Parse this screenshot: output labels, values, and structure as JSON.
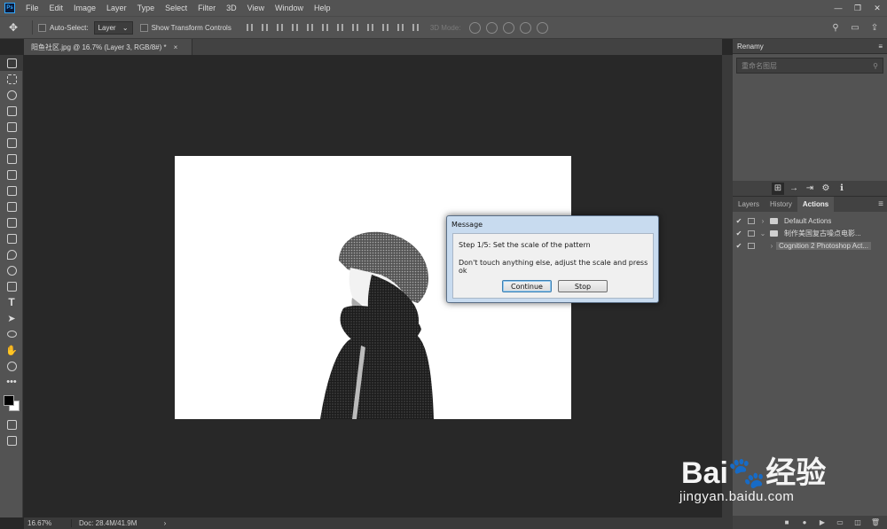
{
  "app": {
    "logo": "Ps",
    "menu": [
      "File",
      "Edit",
      "Image",
      "Layer",
      "Type",
      "Select",
      "Filter",
      "3D",
      "View",
      "Window",
      "Help"
    ],
    "window_controls": [
      "—",
      "❐",
      "✕"
    ]
  },
  "options": {
    "auto_select_label": "Auto-Select:",
    "auto_select_value": "Layer",
    "show_transform_label": "Show Transform Controls",
    "mode_3d_label": "3D Mode:"
  },
  "document": {
    "tab_title": "阳鱼社区.jpg @ 16.7% (Layer 3, RGB/8#) *",
    "tab_close": "×"
  },
  "status": {
    "zoom": "16.67%",
    "doc_size": "Doc: 28.4M/41.9M",
    "arrow": "›"
  },
  "renamy": {
    "title": "Renamy",
    "search_placeholder": "重命名图层"
  },
  "panel_tabs": {
    "layers": "Layers",
    "history": "History",
    "actions": "Actions"
  },
  "actions": {
    "items": [
      {
        "name": "Default Actions"
      },
      {
        "name": "制作美国复古噪点电影..."
      },
      {
        "name": "Cognition 2 Photoshop Act..."
      }
    ]
  },
  "dialog": {
    "title": "Message",
    "line1": "Step 1/5: Set the scale of the pattern",
    "line2": "Don't touch anything else, adjust the scale and press ok",
    "continue_label": "Continue",
    "stop_label": "Stop"
  },
  "watermark": {
    "logo_text": "Bai🐾经验",
    "url": "jingyan.baidu.com"
  },
  "colors": {
    "panel_bg": "#535353",
    "canvas_bg": "#282828",
    "accent": "#31a8ff"
  }
}
